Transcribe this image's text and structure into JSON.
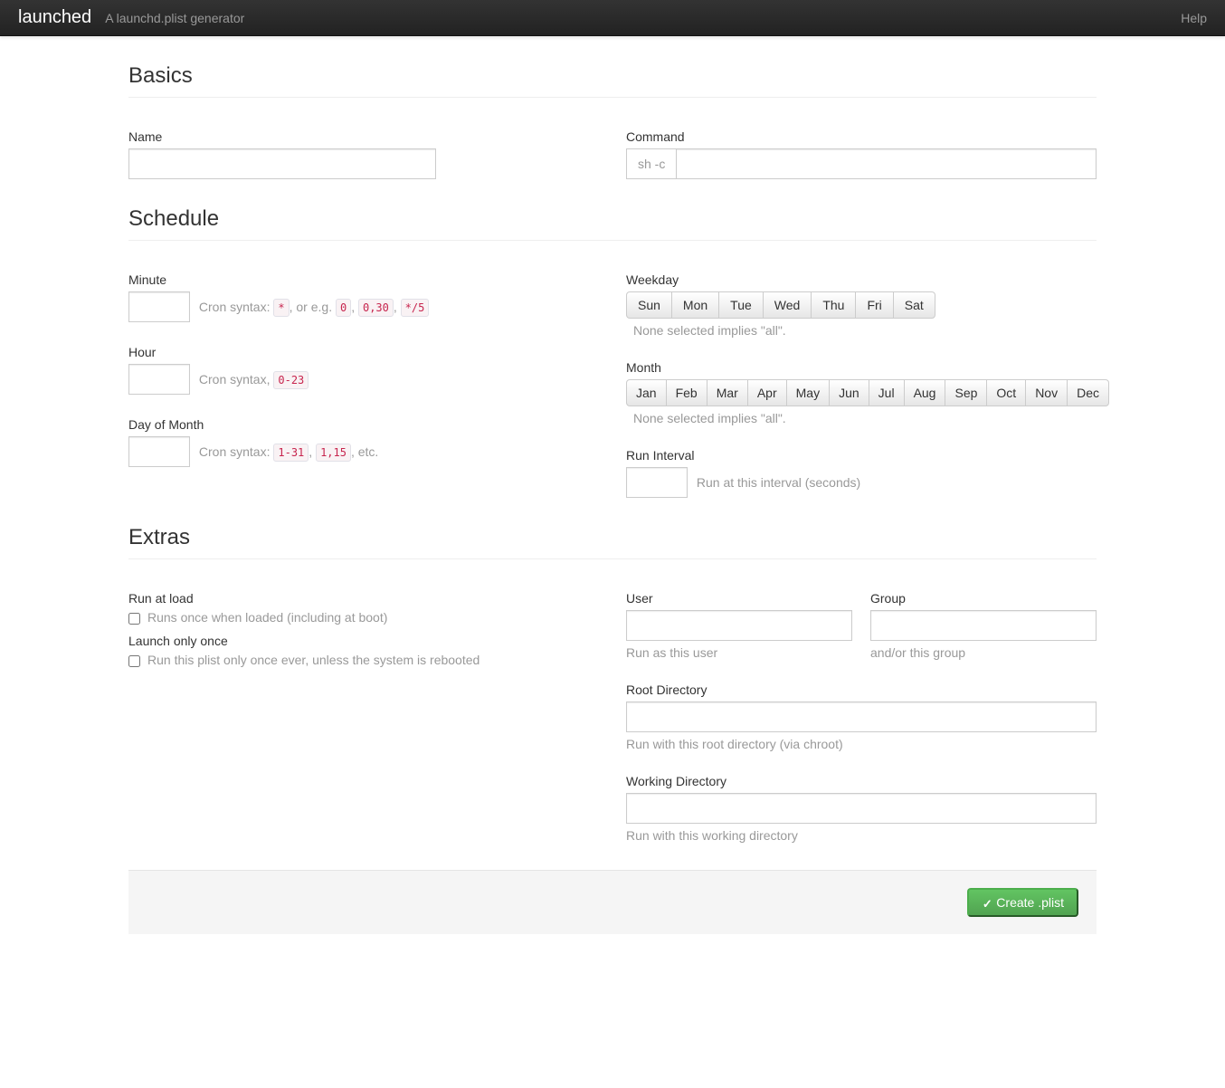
{
  "navbar": {
    "brand": "launched",
    "tagline": "A launchd.plist generator",
    "help": "Help"
  },
  "sections": {
    "basics": "Basics",
    "schedule": "Schedule",
    "extras": "Extras"
  },
  "basics": {
    "name_label": "Name",
    "command_label": "Command",
    "command_prefix": "sh -c"
  },
  "schedule": {
    "minute": {
      "label": "Minute",
      "help_prefix": "Cron syntax: ",
      "ex1": "*",
      "help_mid": ", or e.g. ",
      "ex2": "0",
      "sep": ", ",
      "ex3": "0,30",
      "ex4": "*/5"
    },
    "hour": {
      "label": "Hour",
      "help": "Cron syntax, ",
      "ex1": "0-23"
    },
    "day_of_month": {
      "label": "Day of Month",
      "help_prefix": "Cron syntax: ",
      "ex1": "1-31",
      "sep": ", ",
      "ex2": "1,15",
      "help_suffix": ", etc."
    },
    "weekday": {
      "label": "Weekday",
      "help": "None selected implies \"all\".",
      "days": [
        "Sun",
        "Mon",
        "Tue",
        "Wed",
        "Thu",
        "Fri",
        "Sat"
      ]
    },
    "month": {
      "label": "Month",
      "help": "None selected implies \"all\".",
      "months": [
        "Jan",
        "Feb",
        "Mar",
        "Apr",
        "May",
        "Jun",
        "Jul",
        "Aug",
        "Sep",
        "Oct",
        "Nov",
        "Dec"
      ]
    },
    "interval": {
      "label": "Run Interval",
      "help": "Run at this interval (seconds)"
    }
  },
  "extras": {
    "run_at_load": {
      "label": "Run at load",
      "desc": "Runs once when loaded (including at boot)"
    },
    "launch_once": {
      "label": "Launch only once",
      "desc": "Run this plist only once ever, unless the system is rebooted"
    },
    "user": {
      "label": "User",
      "help": "Run as this user"
    },
    "group": {
      "label": "Group",
      "help": "and/or this group"
    },
    "root_dir": {
      "label": "Root Directory",
      "help": "Run with this root directory (via chroot)"
    },
    "working_dir": {
      "label": "Working Directory",
      "help": "Run with this working directory"
    }
  },
  "actions": {
    "create": "Create .plist"
  }
}
